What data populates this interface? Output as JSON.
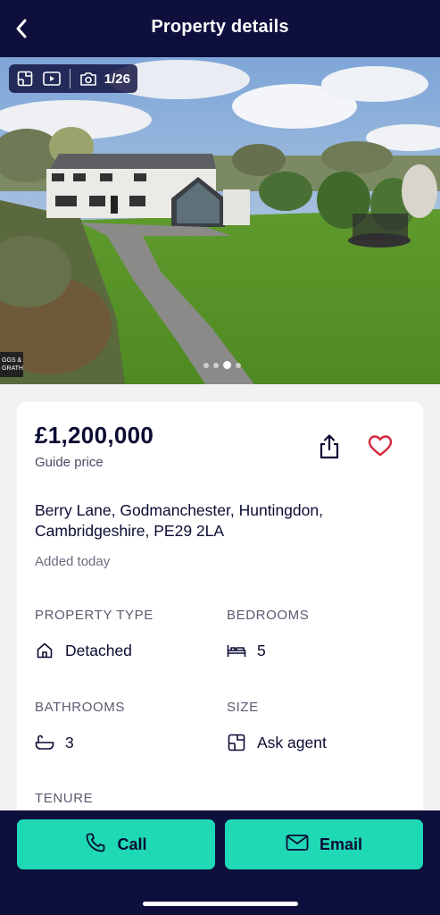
{
  "header": {
    "title": "Property details",
    "back_icon": "chevron-left-icon"
  },
  "gallery": {
    "photo_index": 1,
    "photo_total": 26,
    "counter": "1/26",
    "icons": [
      "floorplan-icon",
      "video-icon",
      "camera-icon"
    ],
    "watermark": "GGS & GRATH"
  },
  "listing": {
    "price": "£1,200,000",
    "price_qualifier": "Guide price",
    "address": "Berry Lane, Godmanchester, Huntingdon, Cambridgeshire, PE29 2LA",
    "added": "Added today"
  },
  "attributes": {
    "property_type": {
      "label": "PROPERTY TYPE",
      "value": "Detached",
      "icon": "house-icon"
    },
    "bedrooms": {
      "label": "BEDROOMS",
      "value": "5",
      "icon": "bed-icon"
    },
    "bathrooms": {
      "label": "BATHROOMS",
      "value": "3",
      "icon": "bath-icon"
    },
    "size": {
      "label": "SIZE",
      "value": "Ask agent",
      "icon": "floorplan-icon"
    },
    "tenure": {
      "label": "TENURE"
    }
  },
  "actions": {
    "call_label": "Call",
    "email_label": "Email"
  },
  "colors": {
    "navy": "#0e0f3d",
    "accent": "#1fd8b4",
    "favourite": "#d3283a"
  }
}
